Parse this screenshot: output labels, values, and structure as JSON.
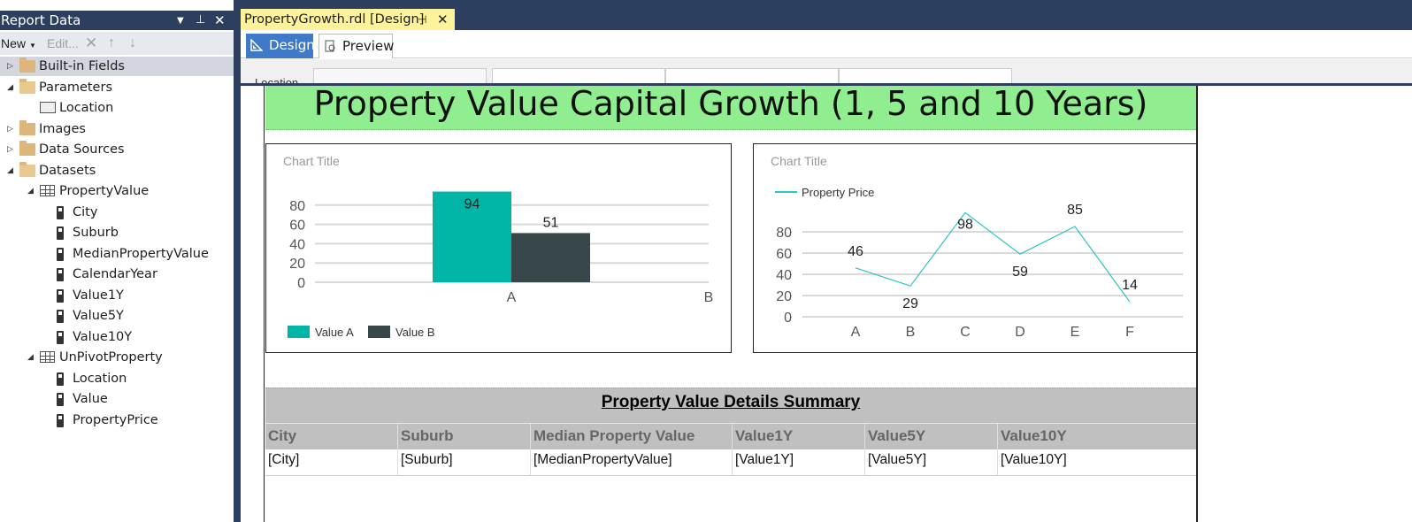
{
  "report_data_pane": {
    "title": "Report Data",
    "toolbar": {
      "new_label": "New",
      "edit_label": "Edit..."
    },
    "tree": [
      {
        "label": "Built-in Fields",
        "kind": "folder",
        "indent": 0,
        "expander": "collapsed",
        "selected": true
      },
      {
        "label": "Parameters",
        "kind": "folder-open",
        "indent": 0,
        "expander": "expanded"
      },
      {
        "label": "Location",
        "kind": "parameter",
        "indent": 1
      },
      {
        "label": "Images",
        "kind": "folder",
        "indent": 0,
        "expander": "collapsed"
      },
      {
        "label": "Data Sources",
        "kind": "folder",
        "indent": 0,
        "expander": "collapsed"
      },
      {
        "label": "Datasets",
        "kind": "folder-open",
        "indent": 0,
        "expander": "expanded"
      },
      {
        "label": "PropertyValue",
        "kind": "dataset",
        "indent": 1,
        "expander": "expanded"
      },
      {
        "label": "City",
        "kind": "field",
        "indent": 2
      },
      {
        "label": "Suburb",
        "kind": "field",
        "indent": 2
      },
      {
        "label": "MedianPropertyValue",
        "kind": "field",
        "indent": 2
      },
      {
        "label": "CalendarYear",
        "kind": "field",
        "indent": 2
      },
      {
        "label": "Value1Y",
        "kind": "field",
        "indent": 2
      },
      {
        "label": "Value5Y",
        "kind": "field",
        "indent": 2
      },
      {
        "label": "Value10Y",
        "kind": "field",
        "indent": 2
      },
      {
        "label": "UnPivotProperty",
        "kind": "dataset",
        "indent": 1,
        "expander": "expanded"
      },
      {
        "label": "Location",
        "kind": "field",
        "indent": 2
      },
      {
        "label": "Value",
        "kind": "field",
        "indent": 2
      },
      {
        "label": "PropertyPrice",
        "kind": "field",
        "indent": 2
      }
    ]
  },
  "document_tab": {
    "label": "PropertyGrowth.rdl [Design]"
  },
  "view_tabs": {
    "design": "Design",
    "preview": "Preview"
  },
  "parameter_area": {
    "label": "Location"
  },
  "report": {
    "title": "Property Value Capital Growth (1, 5 and 10 Years)",
    "summary_title": "Property Value Details Summary",
    "table": {
      "headers": [
        "City",
        "Suburb",
        "Median Property Value",
        "Value1Y",
        "Value5Y",
        "Value10Y"
      ],
      "row": [
        "[City]",
        "[Suburb]",
        "[MedianPropertyValue]",
        "[Value1Y]",
        "[Value5Y]",
        "[Value10Y]"
      ]
    }
  },
  "colors": {
    "title_band": "#90ee90",
    "chrome": "#2d3f5e",
    "teal": "#00b5a5",
    "slate": "#37474a",
    "line": "#2ec4c4"
  },
  "chart_data": [
    {
      "type": "bar",
      "title": "Chart Title",
      "categories": [
        "A",
        "B"
      ],
      "series": [
        {
          "name": "Value A",
          "values": [
            94,
            null
          ],
          "color": "#00b5a5"
        },
        {
          "name": "Value B",
          "values": [
            51,
            null
          ],
          "color": "#37474a"
        }
      ],
      "yticks": [
        0,
        20,
        40,
        60,
        80
      ],
      "ylim": [
        0,
        100
      ],
      "legend": "bottom-left",
      "grid": true
    },
    {
      "type": "line",
      "title": "Chart Title",
      "categories": [
        "A",
        "B",
        "C",
        "D",
        "E",
        "F"
      ],
      "series": [
        {
          "name": "Property Price",
          "values": [
            46,
            29,
            98,
            59,
            85,
            14
          ],
          "color": "#2ec4c4"
        }
      ],
      "yticks": [
        0,
        20,
        40,
        60,
        80
      ],
      "ylim": [
        0,
        100
      ],
      "legend": "top-left",
      "grid": true
    }
  ]
}
